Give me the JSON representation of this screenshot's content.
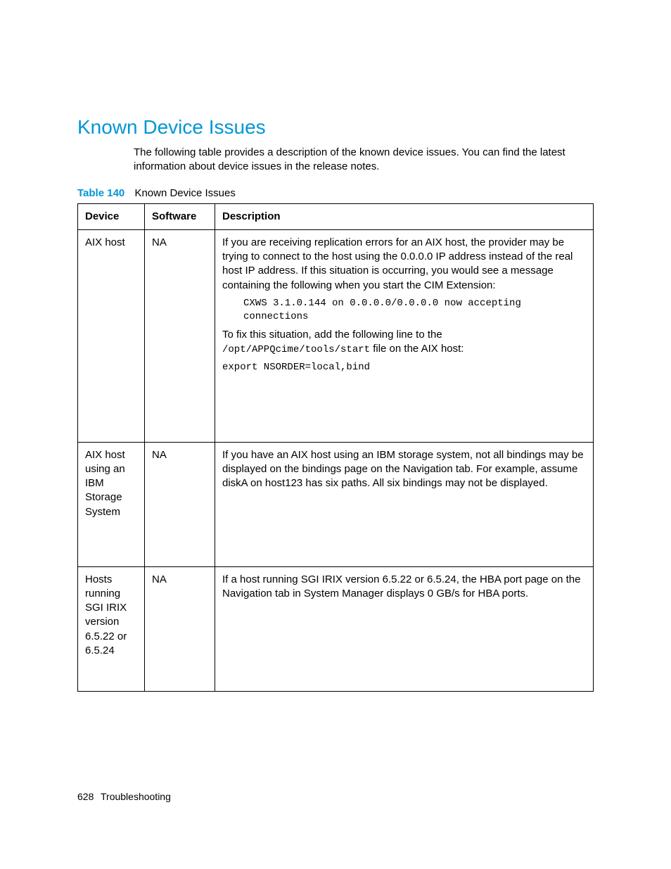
{
  "heading": "Known Device Issues",
  "intro": "The following table provides a description of the known device issues. You can find the latest information about device issues in the release notes.",
  "table_label_prefix": "Table 140",
  "table_label_caption": "Known Device Issues",
  "columns": {
    "device": "Device",
    "software": "Software",
    "description": "Description"
  },
  "rows": [
    {
      "device": "AIX host",
      "software": "NA",
      "desc": {
        "p1": "If you are receiving replication errors for an AIX host, the provider may be trying to connect to the host using the 0.0.0.0 IP address instead of the real host IP address. If this situation is occurring, you would see a message containing the following when you start the CIM Extension:",
        "code1": "CXWS 3.1.0.144 on 0.0.0.0/0.0.0.0 now accepting connections",
        "p2_a": "To fix this situation, add the following line to the ",
        "p2_code": "/opt/APPQcime/tools/start",
        "p2_b": " file on the AIX host:",
        "code2": "export NSORDER=local,bind"
      }
    },
    {
      "device": "AIX host using an IBM Storage System",
      "software": "NA",
      "desc": {
        "p1": "If you have an AIX host using an IBM storage system, not all bindings may be displayed on the bindings page on the Navigation tab. For example, assume diskA on host123 has six paths. All six bindings may not be displayed."
      }
    },
    {
      "device": "Hosts running SGI IRIX version 6.5.22 or 6.5.24",
      "software": "NA",
      "desc": {
        "p1": "If a host running SGI IRIX version 6.5.22 or 6.5.24, the HBA port page on the Navigation tab in System Manager displays 0 GB/s for HBA ports."
      }
    }
  ],
  "footer": {
    "page_number": "628",
    "section": "Troubleshooting"
  }
}
